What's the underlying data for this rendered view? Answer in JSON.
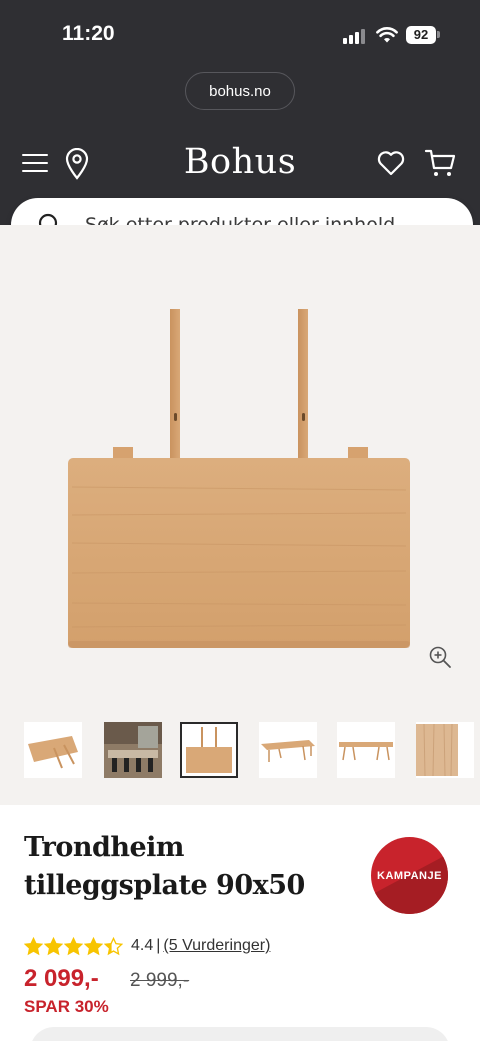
{
  "status_bar": {
    "time": "11:20",
    "battery": "92"
  },
  "browser": {
    "url": "bohus.no"
  },
  "header": {
    "logo": "Bohus"
  },
  "search": {
    "placeholder": "Søk etter produkter eller innhold..."
  },
  "product": {
    "title": "Trondheim tilleggsplate 90x50",
    "badge": "KAMPANJE",
    "rating_value": "4.4",
    "rating_separator": "|",
    "reviews_link": "(5 Vurderinger)",
    "rating_stars": 4.4,
    "price": "2 099,-",
    "old_price": "2 999,-",
    "savings": "SPAR 30%"
  },
  "gallery": {
    "thumbnail_count": 6,
    "active_thumbnail": 3
  },
  "colors": {
    "header_bg": "#2f2f33",
    "accent_red": "#c8232c",
    "star_yellow": "#f7c400",
    "wood": "#d9a877"
  }
}
